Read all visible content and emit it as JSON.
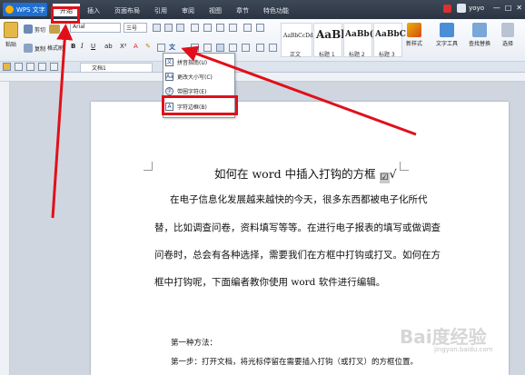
{
  "titlebar": {
    "app_button": "WPS 文字",
    "tabs": [
      "开始",
      "插入",
      "页面布局",
      "引用",
      "审阅",
      "视图",
      "章节",
      "特色功能"
    ],
    "active_tab": "开始",
    "user": "yoyo"
  },
  "ribbon": {
    "cut": "剪切",
    "copy": "复制",
    "format_painter": "格式刷",
    "paste": "粘贴",
    "font_name": "Arial",
    "font_size": "三号",
    "styles": [
      {
        "sample": "AaBbCcDd",
        "label": "正文"
      },
      {
        "sample": "AaBl",
        "label": "标题 1"
      },
      {
        "sample": "AaBb(",
        "label": "标题 2"
      },
      {
        "sample": "AaBbC",
        "label": "标题 3"
      }
    ],
    "new_style": "新样式",
    "text_tool": "文字工具",
    "find_replace": "查找替换",
    "select": "选择"
  },
  "doc_tab": "文档1",
  "dropdown": {
    "items": [
      "拼音指南(U)",
      "更改大小写(C)",
      "带圈字符(E)",
      "字符边框(B)"
    ]
  },
  "document": {
    "title": "如何在 word 中插入打钩的方框",
    "title_check": "☑",
    "title_tick": "√",
    "lines": [
      "在电子信息化发展越来越快的今天，很多东西都被电子化所代",
      "替，比如调查问卷，资料填写等等。在进行电子报表的填写或做调查",
      "问卷时，总会有各种选择，需要我们在方框中打钩或打叉。如何在方",
      "框中打钩呢，下面编者教你使用 word 软件进行编辑。"
    ],
    "method": "第一种方法：",
    "step1": "第一步：打开文档，将光标停留在需要插入打钩（或打叉）的方框位置。"
  },
  "watermark": {
    "brand": "Bai度经验",
    "url": "jingyan.baidu.com"
  },
  "colors": {
    "annotation_red": "#e0101a",
    "title_bar": "#2b3441",
    "wps_blue": "#1f6fd0"
  }
}
